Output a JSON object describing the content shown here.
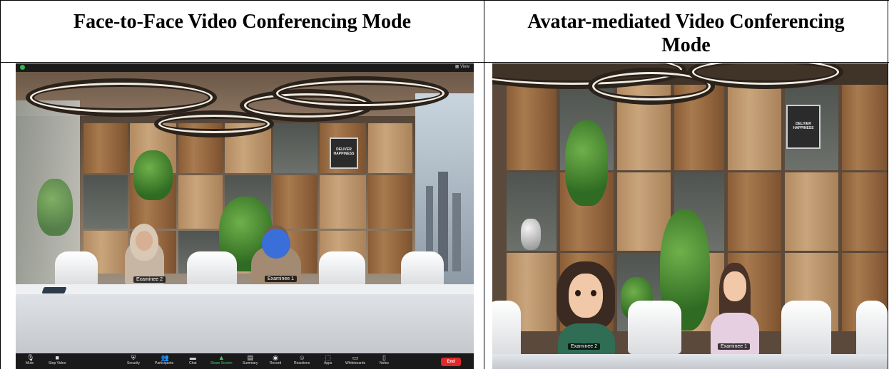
{
  "headers": {
    "left": "Face-to-Face Video Conferencing Mode",
    "right_line1": "Avatar-mediated Video Conferencing",
    "right_line2": "Mode"
  },
  "left_panel": {
    "top_right_label": "View",
    "participants": [
      "Examinee 2",
      "Examinee 1"
    ],
    "poster_text": "DELIVER HAPPINESS",
    "toolbar": [
      {
        "label": "Mute",
        "icon": "microphone-icon"
      },
      {
        "label": "Stop Video",
        "icon": "video-camera-icon"
      },
      {
        "label": "Security",
        "icon": "shield-icon"
      },
      {
        "label": "Participants",
        "icon": "participants-icon",
        "count": "2"
      },
      {
        "label": "Chat",
        "icon": "chat-icon"
      },
      {
        "label": "Share Screen",
        "icon": "share-screen-icon"
      },
      {
        "label": "Summary",
        "icon": "summary-icon"
      },
      {
        "label": "Record",
        "icon": "record-icon"
      },
      {
        "label": "Reactions",
        "icon": "reactions-icon"
      },
      {
        "label": "Apps",
        "icon": "apps-icon"
      },
      {
        "label": "Whiteboards",
        "icon": "whiteboard-icon"
      },
      {
        "label": "Notes",
        "icon": "notes-icon"
      }
    ],
    "end_label": "End",
    "share_color": "#3fce62",
    "end_color": "#e02828"
  },
  "right_panel": {
    "participants": [
      "Examinee 2",
      "Examinee 1"
    ],
    "poster_text": "DELIVER HAPPINESS"
  }
}
